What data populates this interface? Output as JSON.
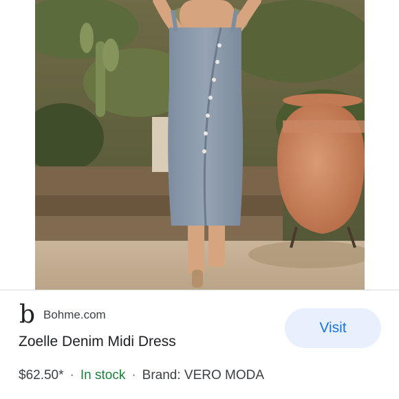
{
  "result": {
    "source": {
      "logo_letter": "b",
      "name": "Bohme.com"
    },
    "title": "Zoelle Denim Midi Dress",
    "price": "$62.50*",
    "separator": "·",
    "stock_status": "In stock",
    "brand": "Brand: VERO MODA",
    "visit_label": "Visit"
  },
  "colors": {
    "stock_green": "#188038",
    "visit_bg": "#e8f0fe",
    "visit_text": "#1a73e8"
  },
  "icons": {
    "source_logo": "bohme-logo-icon"
  }
}
